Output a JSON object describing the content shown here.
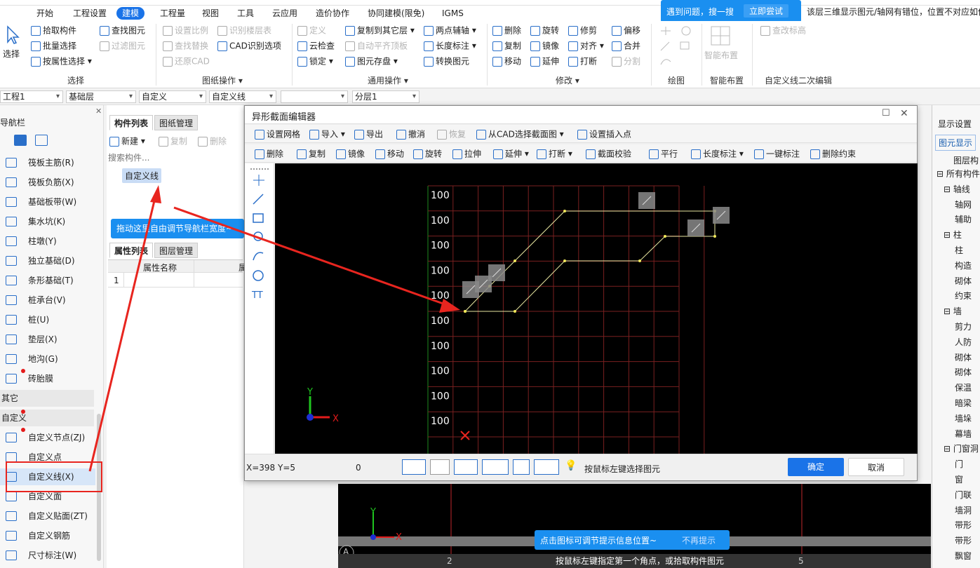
{
  "menu": {
    "items": [
      "开始",
      "工程设置",
      "建模",
      "工程量",
      "视图",
      "工具",
      "云应用",
      "造价协作",
      "协同建模(限免)",
      "IGMS"
    ],
    "active": "建模"
  },
  "help": {
    "text": "遇到问题，搜一搜",
    "action": "立即尝试",
    "message": "该层三维显示图元/轴网有错位，位置不对应如何"
  },
  "ribbon": {
    "select": {
      "big": "选择",
      "pick": "拾取构件",
      "batch": "批量选择",
      "by_attr": "按属性选择",
      "group": "选择"
    },
    "drawing": {
      "set_scale": "设置比例",
      "find_elem": "查找图元",
      "find_replace": "查找替换",
      "restore_cad": "还原CAD",
      "recog_floor": "识别楼层表",
      "filter_elem": "过滤图元",
      "cad_options": "CAD识别选项",
      "group": "图纸操作"
    },
    "common": {
      "define": "定义",
      "cloud_check": "云检查",
      "lock": "锁定",
      "copy_to_floor": "复制到其它层",
      "auto_align": "自动平齐顶板",
      "store": "图元存盘",
      "two_point_axis": "两点辅轴",
      "length_dim": "长度标注",
      "convert": "转换图元",
      "group": "通用操作"
    },
    "modify": {
      "delete": "删除",
      "copy": "复制",
      "move": "移动",
      "rotate": "旋转",
      "mirror": "镜像",
      "extend": "延伸",
      "trim": "修剪",
      "align": "对齐",
      "break": "打断",
      "offset": "偏移",
      "merge": "合并",
      "split": "分割",
      "group": "修改"
    },
    "draw": {
      "group": "绘图"
    },
    "smart": {
      "big": "智能布置",
      "group": "智能布置"
    },
    "custom2": {
      "check_height": "查改标高",
      "group": "自定义线二次编辑"
    }
  },
  "selectors": [
    "工程1",
    "基础层",
    "自定义",
    "自定义线",
    "",
    "分层1"
  ],
  "nav": {
    "title": "导航栏",
    "items": [
      "筏板主筋(R)",
      "筏板负筋(X)",
      "基础板带(W)",
      "集水坑(K)",
      "柱墩(Y)",
      "独立基础(D)",
      "条形基础(T)",
      "桩承台(V)",
      "桩(U)",
      "垫层(X)",
      "地沟(G)",
      "砖胎膜"
    ],
    "section_other": "其它",
    "section_custom": "自定义",
    "custom_items": [
      "自定义节点(ZJ)",
      "自定义点",
      "自定义线(X)",
      "自定义面",
      "自定义贴面(ZT)",
      "自定义钢筋",
      "尺寸标注(W)"
    ]
  },
  "comp": {
    "tab_list": "构件列表",
    "tab_drawing": "图纸管理",
    "new": "新建",
    "copy": "复制",
    "delete": "删除",
    "search_placeholder": "搜索构件...",
    "item": "自定义线",
    "tip": "拖动这里自由调节导航栏宽度~",
    "tab_attr": "属性列表",
    "tab_layer": "图层管理",
    "col_name": "属性名称",
    "col_value": "属",
    "row1": "1"
  },
  "right": {
    "title": "显示设置",
    "tab": "图元显示",
    "header": "图层构",
    "tree": [
      "所有构件",
      "轴线",
      "轴网",
      "辅助",
      "柱",
      "柱",
      "构造",
      "砌体",
      "约束",
      "墙",
      "剪力",
      "人防",
      "砌体",
      "砌体",
      "保温",
      "暗梁",
      "墙垛",
      "幕墙",
      "门窗洞",
      "门",
      "窗",
      "门联",
      "墙洞",
      "带形",
      "带形",
      "飘窗"
    ]
  },
  "dialog": {
    "title": "异形截面编辑器",
    "tb1": {
      "grid": "设置网格",
      "import": "导入",
      "export": "导出",
      "undo": "撤消",
      "redo": "恢复",
      "from_cad": "从CAD选择截面图",
      "insert_point": "设置插入点"
    },
    "tb2": {
      "delete": "删除",
      "copy": "复制",
      "mirror": "镜像",
      "move": "移动",
      "rotate": "旋转",
      "stretch": "拉伸",
      "extend": "延伸",
      "break": "打断",
      "check": "截面校验",
      "parallel": "平行",
      "length": "长度标注",
      "one_click": "一键标注",
      "del_constraint": "删除约束"
    },
    "grid_labels": [
      "100",
      "100",
      "100",
      "100",
      "100",
      "100",
      "100",
      "100",
      "100",
      "100"
    ],
    "coords": "X=398 Y=5",
    "zero": "0",
    "status_hint": "按鼠标左键选择图元",
    "ok": "确定",
    "cancel": "取消"
  },
  "canvas_tip": {
    "text": "点击图标可调节提示信息位置~",
    "dismiss": "不再提示"
  },
  "bottom": {
    "hint": "按鼠标左键指定第一个角点，或拾取构件图元",
    "axis_a": "A",
    "axis_2": "2",
    "axis_5": "5"
  },
  "colors": {
    "accent": "#1a73e8",
    "tip_blue": "#1a8ff0",
    "arrow_red": "#e8251f",
    "grid_red": "#7a2020",
    "grid_green": "#1f8a1f"
  }
}
